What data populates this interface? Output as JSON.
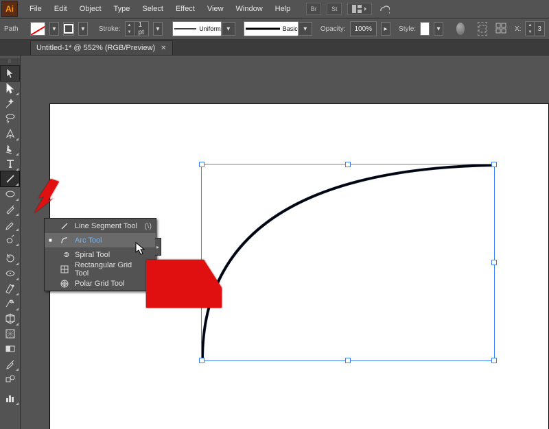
{
  "menubar": {
    "items": [
      "File",
      "Edit",
      "Object",
      "Type",
      "Select",
      "Effect",
      "View",
      "Window",
      "Help"
    ]
  },
  "menubar_right": {
    "br": "Br",
    "st": "St"
  },
  "optbar": {
    "mode": "Path",
    "stroke_label": "Stroke:",
    "stroke_val": "1 pt",
    "brush_uniform": "Uniform",
    "brush_basic": "Basic",
    "opacity_label": "Opacity:",
    "opacity_val": "100%",
    "style_label": "Style:",
    "x_label": "X:",
    "x_val": "3"
  },
  "tab": {
    "title": "Untitled-1* @ 552% (RGB/Preview)"
  },
  "tools": [
    {
      "name": "selection-tool",
      "sel": true,
      "glyph": "sel",
      "corner": false
    },
    {
      "name": "direct-selection-tool",
      "glyph": "dsel",
      "corner": true
    },
    {
      "name": "magic-wand-tool",
      "glyph": "wand",
      "corner": false
    },
    {
      "name": "lasso-tool",
      "glyph": "lasso",
      "corner": false
    },
    {
      "name": "pen-tool",
      "glyph": "pen",
      "corner": true
    },
    {
      "name": "curvature-tool",
      "glyph": "curv",
      "corner": true
    },
    {
      "name": "type-tool",
      "glyph": "type",
      "corner": true
    },
    {
      "name": "line-segment-tool",
      "glyph": "line",
      "corner": true,
      "open": true
    },
    {
      "name": "shape-tool",
      "glyph": "ellipse",
      "corner": true
    },
    {
      "name": "paintbrush-tool",
      "glyph": "brush",
      "corner": true
    },
    {
      "name": "pencil-tool",
      "glyph": "pencil",
      "corner": true
    },
    {
      "name": "blob-brush-tool",
      "glyph": "blob",
      "corner": true
    },
    {
      "gap": true
    },
    {
      "name": "rotate-tool",
      "glyph": "rotate",
      "corner": true
    },
    {
      "name": "width-tool",
      "glyph": "width",
      "corner": true
    },
    {
      "name": "free-transform-tool",
      "glyph": "free",
      "corner": true
    },
    {
      "name": "shape-builder-tool",
      "glyph": "sb",
      "corner": true
    },
    {
      "name": "perspective-grid-tool",
      "glyph": "persp",
      "corner": true
    },
    {
      "name": "mesh-tool",
      "glyph": "mesh",
      "corner": false
    },
    {
      "name": "gradient-tool",
      "glyph": "grad",
      "corner": false
    },
    {
      "name": "eyedropper-tool",
      "glyph": "eyed",
      "corner": true
    },
    {
      "name": "blend-tool",
      "glyph": "blend",
      "corner": false
    },
    {
      "gap": true
    },
    {
      "name": "column-graph-tool",
      "glyph": "graph",
      "corner": true
    }
  ],
  "flyout": {
    "items": [
      {
        "label": "Line Segment Tool",
        "shortcut": "(\\)",
        "icon": "line",
        "sel": false
      },
      {
        "label": "Arc Tool",
        "shortcut": "",
        "icon": "arc",
        "sel": true,
        "mark": true
      },
      {
        "label": "Spiral Tool",
        "shortcut": "",
        "icon": "spiral",
        "sel": false
      },
      {
        "label": "Rectangular Grid Tool",
        "shortcut": "",
        "icon": "rgrid",
        "sel": false
      },
      {
        "label": "Polar Grid Tool",
        "shortcut": "",
        "icon": "pgrid",
        "sel": false
      }
    ]
  }
}
